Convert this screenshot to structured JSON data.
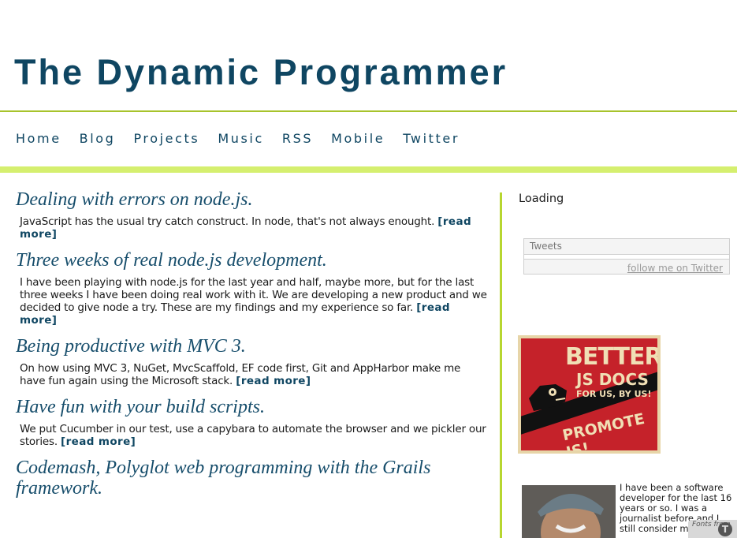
{
  "site": {
    "title": "The Dynamic Programmer"
  },
  "nav": {
    "items": [
      {
        "label": "Home"
      },
      {
        "label": "Blog"
      },
      {
        "label": "Projects"
      },
      {
        "label": "Music"
      },
      {
        "label": "RSS"
      },
      {
        "label": "Mobile"
      },
      {
        "label": "Twitter"
      }
    ]
  },
  "posts": [
    {
      "title": "Dealing with errors on node.js.",
      "excerpt": "JavaScript has the usual try catch construct. In node, that's not always enought.",
      "read_more": "[read more]"
    },
    {
      "title": "Three weeks of real node.js development.",
      "excerpt": "I have been playing with node.js for the last year and half, maybe more, but for the last three weeks I have been doing real work with it. We are developing a new product and we decided to give node a try. These are my findings and my experience so far.",
      "read_more": "[read more]"
    },
    {
      "title": "Being productive with MVC 3.",
      "excerpt": "On how using MVC 3, NuGet, MvcScaffold, EF code first, Git and AppHarbor make me have fun again using the Microsoft stack.",
      "read_more": "[read more]"
    },
    {
      "title": "Have fun with your build scripts.",
      "excerpt": "We put Cucumber in our test, use a capybara to automate the browser and we pickler our stories.",
      "read_more": "[read more]"
    },
    {
      "title": "Codemash, Polyglot web programming with the Grails framework.",
      "excerpt": "",
      "read_more": ""
    }
  ],
  "sidebar": {
    "loading": "Loading",
    "tweets": {
      "header": "Tweets",
      "follow_link": "follow me on Twitter"
    },
    "badge": {
      "line1": "BETTER",
      "line2": "JS DOCS",
      "line3": "FOR US, BY US!",
      "line4": "PROMOTE JS!"
    },
    "bio": "I have been a software developer for the last 16 years or so. I was a journalist before and I still consider myself one."
  },
  "fonts_badge": {
    "label": "Fonts from",
    "icon": "T"
  },
  "colors": {
    "brand": "#0f4662",
    "accent": "#a7c32c",
    "accent_light": "#d5ef6f"
  }
}
